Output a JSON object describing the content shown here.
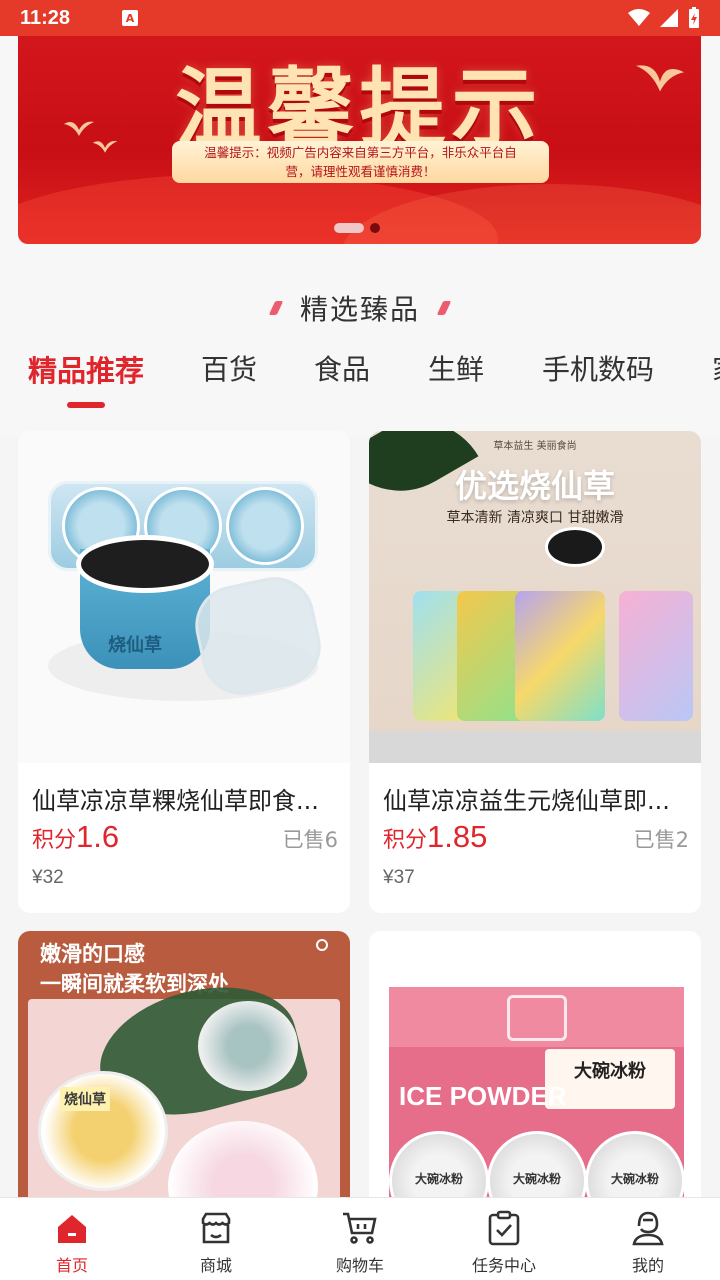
{
  "status_bar": {
    "time": "11:28",
    "notification_icon": "A"
  },
  "banner": {
    "title": "温馨提示",
    "notice_line1": "温馨提示：视频广告内容来自第三方平台，非乐众平台自",
    "notice_line2": "营，请理性观看谨慎消费！",
    "slide_count": 2,
    "active_slide": 1
  },
  "section": {
    "title": "精选臻品"
  },
  "tabs": [
    {
      "label": "精品推荐",
      "active": true
    },
    {
      "label": "百货",
      "active": false
    },
    {
      "label": "食品",
      "active": false
    },
    {
      "label": "生鲜",
      "active": false
    },
    {
      "label": "手机数码",
      "active": false
    },
    {
      "label": "家",
      "active": false
    }
  ],
  "products": [
    {
      "title": "仙草凉凉草粿烧仙草即食...",
      "points_label": "积分",
      "points": "1.6",
      "sold": "已售6",
      "price": "¥32",
      "image": {
        "cup_label": "烧仙草"
      }
    },
    {
      "title": "仙草凉凉益生元烧仙草即...",
      "points_label": "积分",
      "points": "1.85",
      "sold": "已售2",
      "price": "¥37",
      "image": {
        "top_text": "草本益生 美丽食尚",
        "headline": "优选烧仙草",
        "subline": "草本清新 清凉爽口 甘甜嫩滑"
      }
    },
    {
      "image": {
        "line1": "嫩滑的口感",
        "line2": "一瞬间就柔软到深处",
        "cup_label": "烧仙草"
      }
    },
    {
      "image": {
        "box_label": "大碗冰粉",
        "brand": "ICE POWDER",
        "cup_label": "大碗冰粉"
      }
    }
  ],
  "bottom_nav": [
    {
      "label": "首页",
      "icon": "home-icon",
      "active": true
    },
    {
      "label": "商城",
      "icon": "store-icon",
      "active": false
    },
    {
      "label": "购物车",
      "icon": "cart-icon",
      "active": false
    },
    {
      "label": "任务中心",
      "icon": "task-icon",
      "active": false
    },
    {
      "label": "我的",
      "icon": "user-icon",
      "active": false
    }
  ],
  "colors": {
    "accent": "#e0262d",
    "status_bar": "#e53a2a"
  }
}
